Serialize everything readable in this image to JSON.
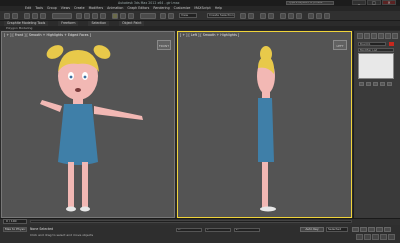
{
  "app": {
    "title": "Autodesk 3ds Max 2012 x64 - girl.max"
  },
  "search": {
    "placeholder": "Type a keyword or phrase"
  },
  "window_controls": {
    "minimize": "_",
    "maximize": "□",
    "close": "✕"
  },
  "menus": [
    "Edit",
    "Tools",
    "Group",
    "Views",
    "Create",
    "Modifiers",
    "Animation",
    "Graph Editors",
    "Rendering",
    "Customize",
    "MAXScript",
    "Help"
  ],
  "toolbar": {
    "view_dropdown": "View",
    "selection_set": "Create Selection Set"
  },
  "ribbon": {
    "tabs": [
      "Graphite Modeling Tools",
      "Freeform",
      "Selection",
      "Object Paint"
    ],
    "subtitle": "Polygon Modeling"
  },
  "viewports": {
    "left": {
      "label": "[ + ] [ Front ] [ Smooth + Highlights + Edged Faces ]",
      "viewcube": "FRONT"
    },
    "right": {
      "label": "[ + ] [ Left ] [ Smooth + Highlights ]",
      "viewcube": "LEFT"
    }
  },
  "command_panel": {
    "name_field": "Box001",
    "modifier_list": "Modifier List",
    "swatch_color": "#c8281e"
  },
  "timeline": {
    "frame": "0 / 100"
  },
  "status": {
    "script_listener": "Max to Physic",
    "selected": "None Selected",
    "hint": "Click and drag to select and move objects",
    "x_label": "X:",
    "y_label": "Y:",
    "z_label": "Z:",
    "auto_key": "Auto Key",
    "key_filter": "Selected"
  },
  "colors": {
    "viewport_bg": "#545454",
    "active_border": "#f0d43a",
    "hair": "#e8c94a",
    "skin": "#f2b8b4",
    "dress": "#3f7fa8",
    "shoe": "#e8e8e8"
  }
}
